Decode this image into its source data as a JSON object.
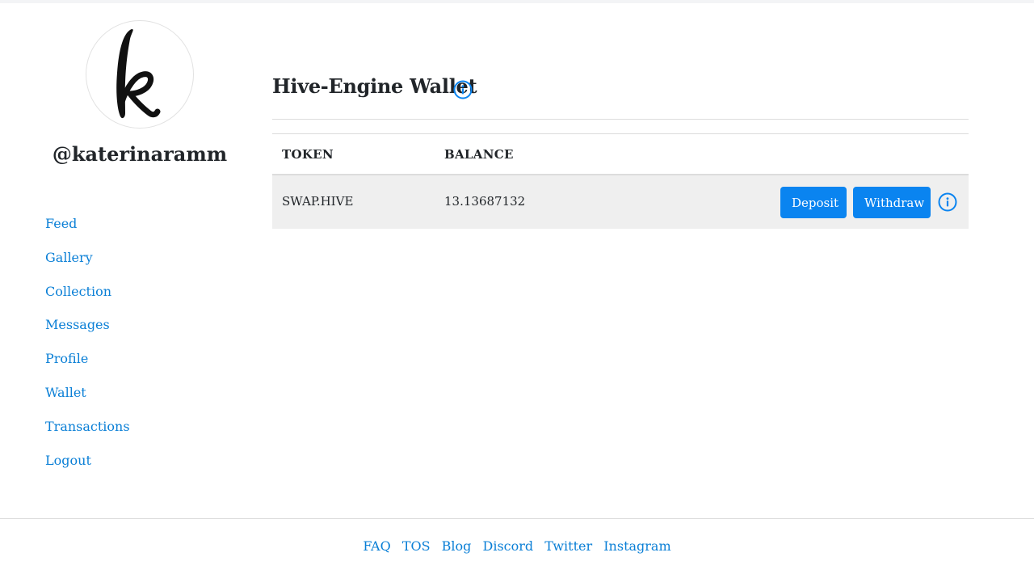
{
  "profile": {
    "avatar_letter": "k",
    "username": "@katerinaramm"
  },
  "sidebar": {
    "items": [
      {
        "label": "Feed"
      },
      {
        "label": "Gallery"
      },
      {
        "label": "Collection"
      },
      {
        "label": "Messages"
      },
      {
        "label": "Profile"
      },
      {
        "label": "Wallet"
      },
      {
        "label": "Transactions"
      },
      {
        "label": "Logout"
      }
    ]
  },
  "wallet": {
    "title": "Hive-Engine Wallet",
    "columns": [
      "TOKEN",
      "BALANCE"
    ],
    "rows": [
      {
        "token": "SWAP.HIVE",
        "balance": "13.13687132"
      }
    ],
    "deposit_label": "Deposit",
    "withdraw_label": "Withdraw"
  },
  "footer": {
    "links": [
      "FAQ",
      "TOS",
      "Blog",
      "Discord",
      "Twitter",
      "Instagram"
    ]
  },
  "colors": {
    "accent": "#0a84f0",
    "link": "#0a7fd6",
    "row_bg": "#efefef"
  },
  "icons": {
    "info": "info-circle-icon"
  }
}
